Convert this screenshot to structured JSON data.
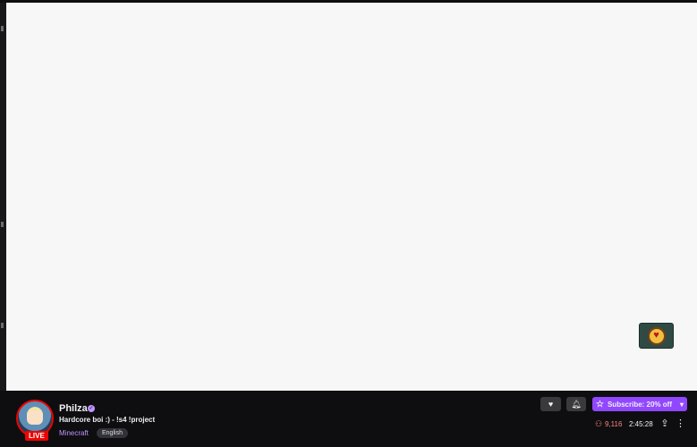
{
  "channel": {
    "name": "Philza",
    "live_label": "LIVE",
    "title": "Hardcore boi :) - !s4 !project",
    "category": "Minecraft",
    "tag": "English"
  },
  "actions": {
    "subscribe_label": "Subscribe: 20% off"
  },
  "stats": {
    "viewers": "9,116",
    "uptime": "2:45:28"
  },
  "colors": {
    "accent": "#9147ff",
    "live": "#eb0400",
    "viewers": "#ff8280",
    "category": "#bf94ff"
  },
  "icons": [
    "verified-icon",
    "heart-icon",
    "bell-icon",
    "star-icon",
    "chevron-down-icon",
    "person-icon",
    "share-icon",
    "more-icon"
  ]
}
